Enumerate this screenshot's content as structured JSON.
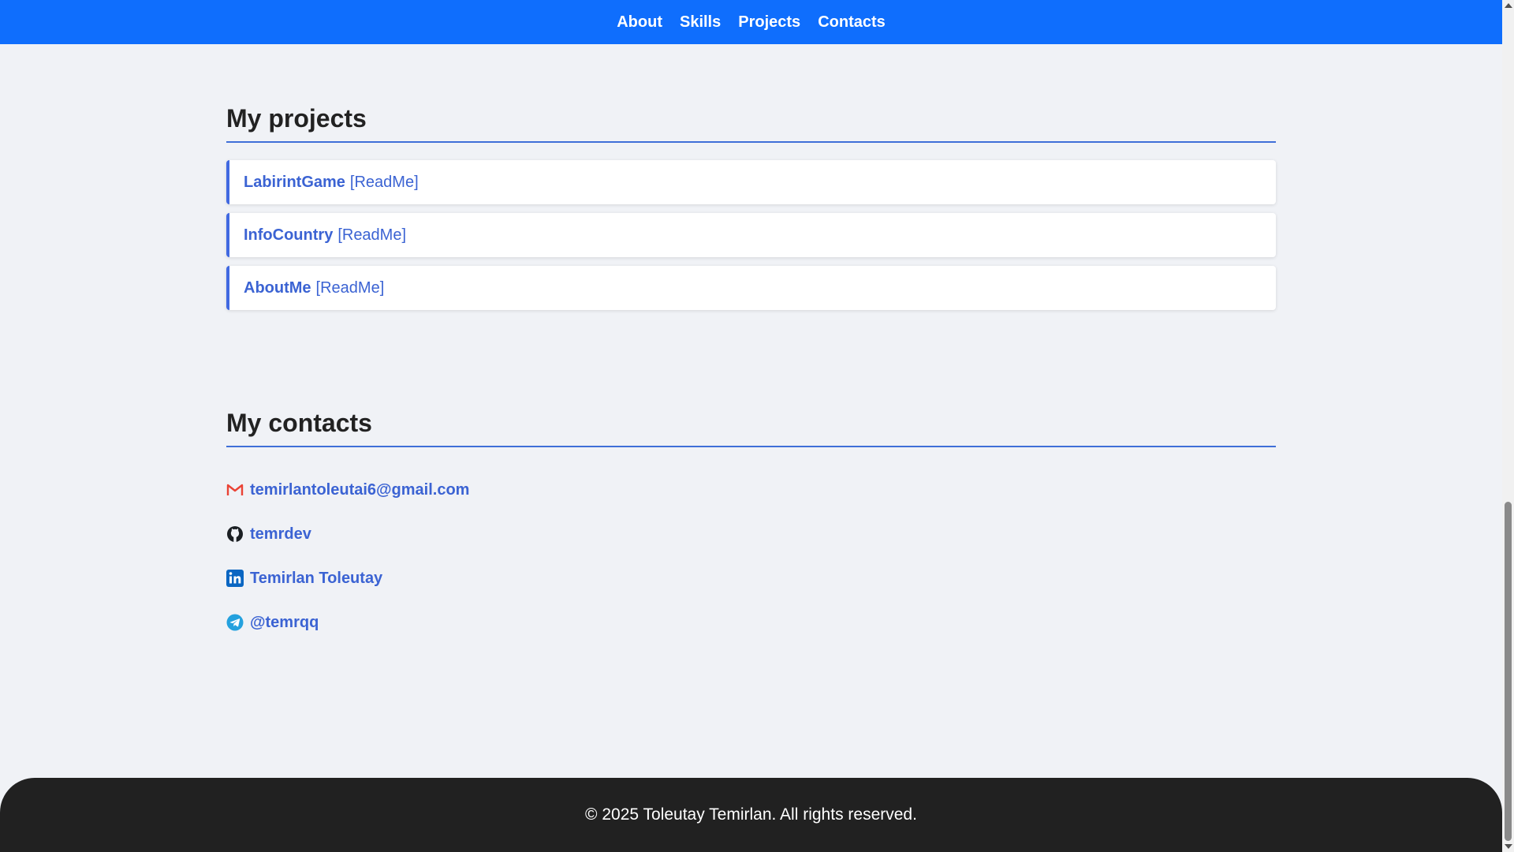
{
  "nav": {
    "items": [
      {
        "label": "About"
      },
      {
        "label": "Skills"
      },
      {
        "label": "Projects"
      },
      {
        "label": "Contacts"
      }
    ]
  },
  "projects": {
    "title": "My projects",
    "items": [
      {
        "name": "LabirintGame",
        "readme": "[ReadMe]"
      },
      {
        "name": "InfoCountry",
        "readme": "[ReadMe]"
      },
      {
        "name": "AboutMe",
        "readme": "[ReadMe]"
      }
    ]
  },
  "contacts": {
    "title": "My contacts",
    "items": [
      {
        "icon": "gmail-icon",
        "label": "temirlantoleutai6@gmail.com"
      },
      {
        "icon": "github-icon",
        "label": "temrdev"
      },
      {
        "icon": "linkedin-icon",
        "label": "Temirlan Toleutay"
      },
      {
        "icon": "telegram-icon",
        "label": "@temrqq"
      }
    ]
  },
  "footer": {
    "text": "© 2025 Toleutay Temirlan. All rights reserved."
  },
  "colors": {
    "nav_bg": "#0f6efd",
    "page_bg": "#f0f2f6",
    "accent": "#3b63d3",
    "footer_bg": "#212121"
  }
}
